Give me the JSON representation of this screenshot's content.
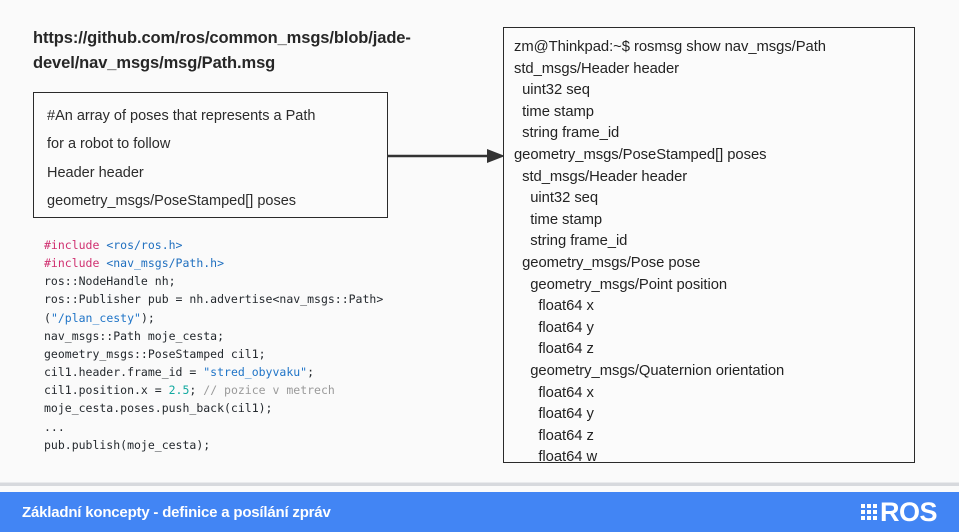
{
  "slide": {
    "background_color": "#fafafa"
  },
  "left": {
    "url_title": "https://github.com/ros/common_msgs/blob/jade-devel/nav_msgs/msg/Path.msg",
    "msg_box": {
      "lines": [
        "#An array of poses that represents a Path",
        "for a robot to follow",
        "Header header",
        "geometry_msgs/PoseStamped[] poses"
      ]
    },
    "code": {
      "language": "cpp",
      "colors": {
        "preprocessor": "#d03070",
        "include_path": "#1f6fbf",
        "string": "#1f74c7",
        "number": "#12a9a0",
        "comment": "#9a9a9a",
        "plain": "#24292e"
      },
      "lines": [
        [
          {
            "t": "#include ",
            "c": "tok-pre"
          },
          {
            "t": "<ros/ros.h>",
            "c": "tok-inc"
          }
        ],
        [
          {
            "t": "#include ",
            "c": "tok-pre"
          },
          {
            "t": "<nav_msgs/Path.h>",
            "c": "tok-inc"
          }
        ],
        [
          {
            "t": "ros::NodeHandle nh;",
            "c": "tok-pln"
          }
        ],
        [
          {
            "t": "ros::Publisher pub = nh.advertise<nav_msgs::Path>",
            "c": "tok-pln"
          }
        ],
        [
          {
            "t": "(",
            "c": "tok-pln"
          },
          {
            "t": "\"/plan_cesty\"",
            "c": "tok-str"
          },
          {
            "t": ");",
            "c": "tok-pln"
          }
        ],
        [
          {
            "t": "nav_msgs::Path moje_cesta;",
            "c": "tok-pln"
          }
        ],
        [
          {
            "t": "geometry_msgs::PoseStamped cil1;",
            "c": "tok-pln"
          }
        ],
        [
          {
            "t": "cil1.header.frame_id = ",
            "c": "tok-pln"
          },
          {
            "t": "\"stred_obyvaku\"",
            "c": "tok-str"
          },
          {
            "t": ";",
            "c": "tok-pln"
          }
        ],
        [
          {
            "t": "cil1.position.x = ",
            "c": "tok-pln"
          },
          {
            "t": "2.5",
            "c": "tok-num"
          },
          {
            "t": "; ",
            "c": "tok-pln"
          },
          {
            "t": "// pozice v metrech",
            "c": "tok-cmt"
          }
        ],
        [
          {
            "t": "moje_cesta.poses.push_back(cil1);",
            "c": "tok-pln"
          }
        ],
        [
          {
            "t": "...",
            "c": "tok-pln"
          }
        ],
        [
          {
            "t": "pub.publish(moje_cesta);",
            "c": "tok-pln"
          }
        ]
      ]
    }
  },
  "arrow": {
    "label": "flow-arrow",
    "color": "#333333"
  },
  "terminal": {
    "prompt": "zm@Thinkpad:~$",
    "command": "rosmsg show nav_msgs/Path",
    "lines": [
      "zm@Thinkpad:~$ rosmsg show nav_msgs/Path",
      "std_msgs/Header header",
      "  uint32 seq",
      "  time stamp",
      "  string frame_id",
      "geometry_msgs/PoseStamped[] poses",
      "  std_msgs/Header header",
      "    uint32 seq",
      "    time stamp",
      "    string frame_id",
      "  geometry_msgs/Pose pose",
      "    geometry_msgs/Point position",
      "      float64 x",
      "      float64 y",
      "      float64 z",
      "    geometry_msgs/Quaternion orientation",
      "      float64 x",
      "      float64 y",
      "      float64 z",
      "      float64 w"
    ]
  },
  "footer": {
    "title": "Základní koncepty - definice a posílání zpráv",
    "logo_text": "ROS",
    "background_color": "#4285f4",
    "text_color": "#ffffff"
  }
}
